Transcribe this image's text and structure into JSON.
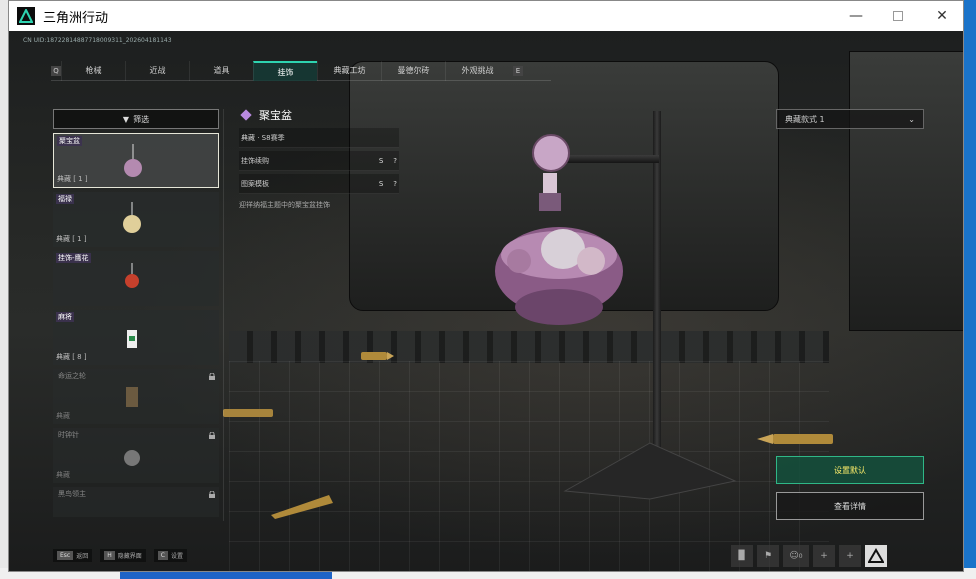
{
  "window": {
    "title": "三角洲行动",
    "minimize_icon": "minimize-icon",
    "maximize_icon": "maximize-icon",
    "close_icon": "close-icon"
  },
  "uid_text": "CN UID:18722814887718009311_202604181143",
  "tabs": {
    "left_key": "Q",
    "right_key": "E",
    "items": [
      {
        "label": "枪械",
        "active": false
      },
      {
        "label": "近战",
        "active": false
      },
      {
        "label": "道具",
        "active": false
      },
      {
        "label": "挂饰",
        "active": true
      },
      {
        "label": "典藏工坊",
        "active": false
      },
      {
        "label": "曼德尔砖",
        "active": false
      },
      {
        "label": "外观挑战",
        "active": false
      }
    ]
  },
  "filter": {
    "label": "筛选",
    "icon": "filter-icon"
  },
  "items": [
    {
      "name": "聚宝盆",
      "meta": "典藏 [ 1 ]",
      "selected": true,
      "locked": false
    },
    {
      "name": "福禄",
      "meta": "典藏 [ 1 ]",
      "selected": false,
      "locked": false
    },
    {
      "name": "挂饰-鹰花",
      "meta": "",
      "selected": false,
      "locked": false
    },
    {
      "name": "麻将",
      "meta": "典藏 [ 8 ]",
      "selected": false,
      "locked": false
    },
    {
      "name": "命运之轮",
      "meta": "典藏",
      "selected": false,
      "locked": true
    },
    {
      "name": "时钟针",
      "meta": "典藏",
      "selected": false,
      "locked": true
    },
    {
      "name": "黑鸟领主",
      "meta": "",
      "selected": false,
      "locked": true
    }
  ],
  "detail": {
    "title": "聚宝盆",
    "icon": "rarity-diamond-icon",
    "rows": [
      {
        "label": "典藏 · S8赛季",
        "mid": "",
        "right": ""
      },
      {
        "label": "挂饰续购",
        "mid": "S",
        "right": "?"
      },
      {
        "label": "图案模板",
        "mid": "S",
        "right": "?"
      }
    ],
    "description": "迎祥纳福主题中的聚宝盆挂饰"
  },
  "style_select": {
    "value": "典藏款式 1"
  },
  "actions": {
    "set_default": "设置默认",
    "view_details": "查看详情"
  },
  "hints": [
    {
      "key": "Esc",
      "label": "返回"
    },
    {
      "key": "H",
      "label": "隐藏界面"
    },
    {
      "key": "C",
      "label": "设置"
    }
  ],
  "toolbar": {
    "stats_icon": "bar-chart-icon",
    "flag_icon": "flag-icon",
    "people_icon": "people-icon",
    "people_count": "0",
    "add1": "+",
    "add2": "+",
    "logo_icon": "delta-logo-icon"
  },
  "colors": {
    "accent": "#2ed3b0",
    "default_btn_text": "#ffef6a",
    "rarity": "#b98ae0"
  }
}
